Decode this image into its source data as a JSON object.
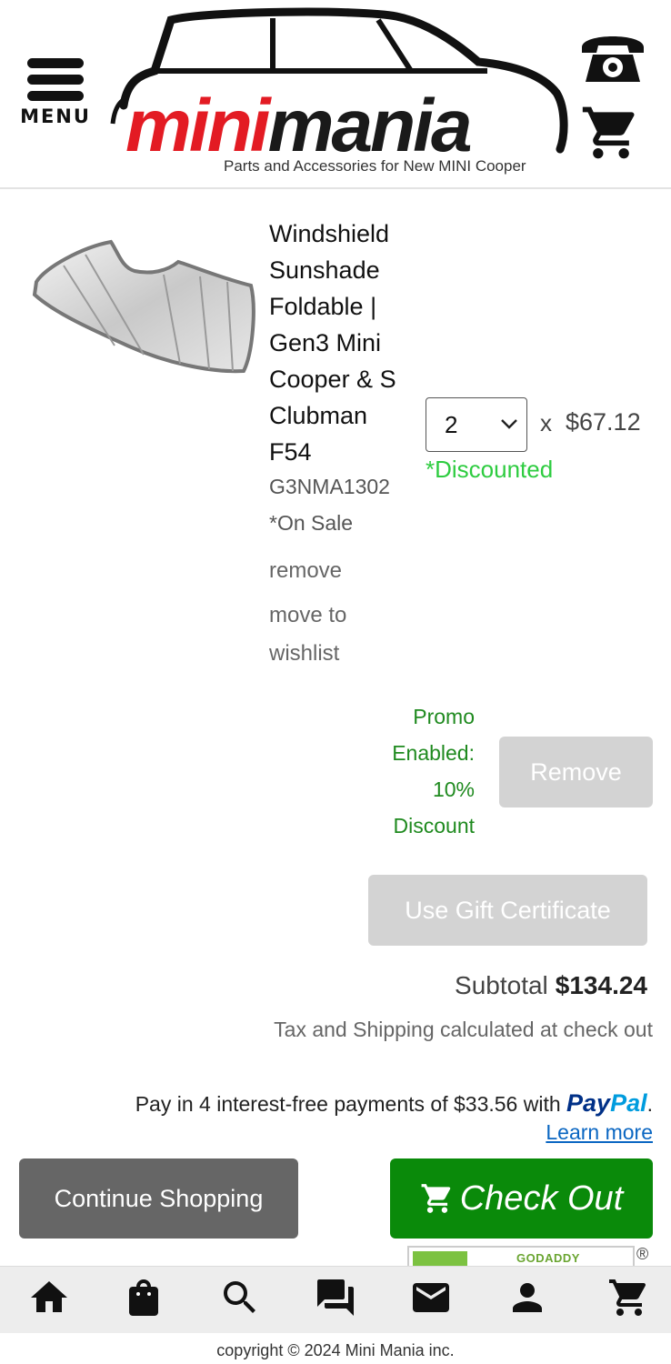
{
  "header": {
    "menu_label": "MENU",
    "logo": {
      "brand_red": "mini",
      "brand_dark": "mania",
      "tagline": "Parts and Accessories for New MINI Cooper"
    },
    "icons": [
      "menu-icon",
      "phone-icon",
      "cart-icon"
    ]
  },
  "cart": {
    "item": {
      "title": "Windshield Sunshade Foldable | Gen3 Mini Cooper & S Clubman F54",
      "sku": "G3NMA1302",
      "sale_note": "*On Sale",
      "remove_link": "remove",
      "wishlist_link": "move to wishlist",
      "quantity": "2",
      "times": "x",
      "unit_price": "$67.12",
      "discount_note": "*Discounted"
    },
    "promo": {
      "text": "Promo Enabled: 10% Discount",
      "remove_button": "Remove"
    },
    "gift_certificate_button": "Use Gift Certificate",
    "subtotal_label": "Subtotal",
    "subtotal_value": "$134.24",
    "tax_note": "Tax and Shipping calculated at check out",
    "paypal": {
      "text": "Pay in 4 interest-free payments of $33.56 with",
      "logo_part1": "Pay",
      "logo_part2": "Pal",
      "period": ".",
      "learn_more": "Learn more"
    },
    "continue_button": "Continue Shopping",
    "checkout_button": "Check Out"
  },
  "seal": {
    "text": "GODADDY",
    "reg": "®"
  },
  "bottom_nav": [
    "home-icon",
    "shopping-bag-icon",
    "search-icon",
    "chat-icon",
    "mail-icon",
    "account-icon",
    "cart-icon"
  ],
  "footer": {
    "copyright": "copyright © 2024 Mini Mania inc."
  },
  "colors": {
    "brand_red": "#e31b23",
    "checkout_green": "#0a8a0a",
    "discount_green": "#2ecc40",
    "promo_green": "#1f8a1f",
    "link_blue": "#0a66c2",
    "paypal_dark": "#003087",
    "paypal_light": "#009cde"
  }
}
